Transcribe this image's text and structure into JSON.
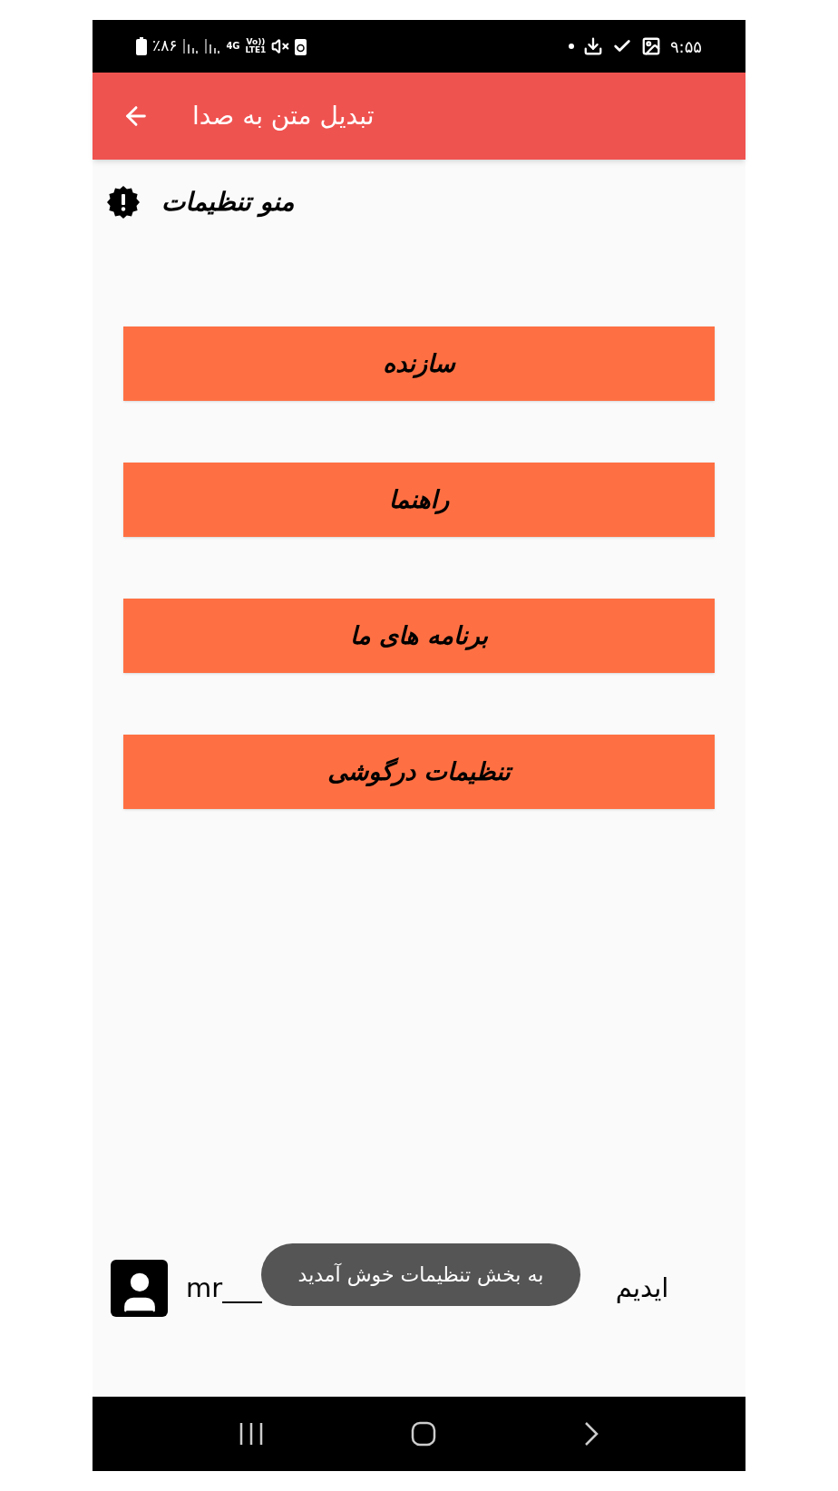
{
  "status_bar": {
    "battery": "٪۸۶",
    "network": "4G",
    "volte": "Vo))",
    "lte": "LTE1",
    "time": "۹:۵۵"
  },
  "app_bar": {
    "title": "تبدیل متن به صدا"
  },
  "section": {
    "title": "منو تنظیمات"
  },
  "menu_buttons": [
    {
      "label": "سازنده"
    },
    {
      "label": "راهنما"
    },
    {
      "label": "برنامه های ما"
    },
    {
      "label": "تنظیمات درگوشی"
    }
  ],
  "contact": {
    "left_text": "mr___",
    "right_text": "ایدیم"
  },
  "toast": {
    "text": "به بخش تنظیمات خوش آمدید"
  }
}
